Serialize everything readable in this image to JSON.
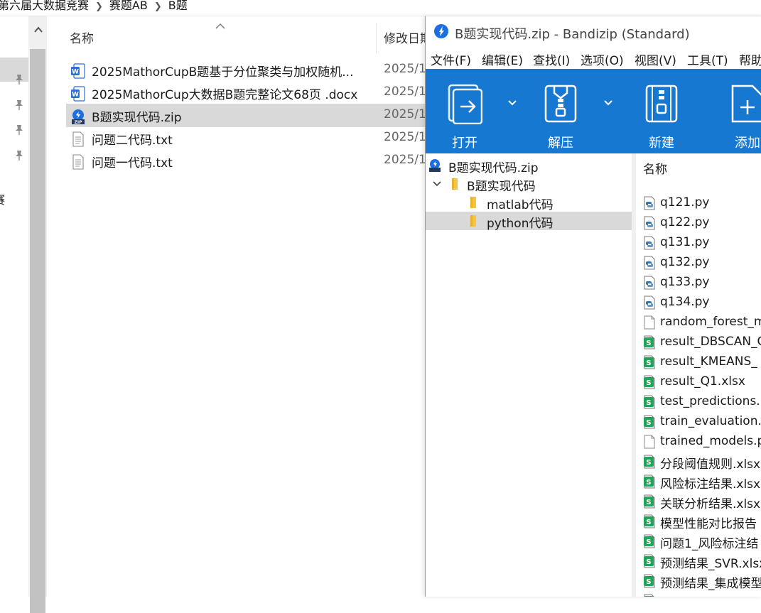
{
  "explorer": {
    "breadcrumb": [
      "第六届大数据竞赛",
      "赛题AB",
      "B题"
    ],
    "nav_partial_text": "赛",
    "columns": {
      "name": "名称",
      "modified": "修改日期"
    },
    "files": [
      {
        "name": "2025MathorCupB题基于分位聚类与加权随机...",
        "date": "2025/1",
        "icon": "word-icon"
      },
      {
        "name": "2025MathorCup大数据B题完整论文68页 .docx",
        "date": "2025/1",
        "icon": "word-icon"
      },
      {
        "name": "B题实现代码.zip",
        "date": "2025/1",
        "icon": "zip-icon",
        "selected": true
      },
      {
        "name": "问题二代码.txt",
        "date": "2025/1",
        "icon": "text-file-icon"
      },
      {
        "name": "问题一代码.txt",
        "date": "2025/1",
        "icon": "text-file-icon"
      }
    ]
  },
  "bandizip": {
    "title": "B题实现代码.zip - Bandizip (Standard)",
    "menu": [
      "文件(F)",
      "编辑(E)",
      "查找(I)",
      "选项(O)",
      "视图(V)",
      "工具(T)",
      "帮助"
    ],
    "toolbar": {
      "open": "打开",
      "extract": "解压",
      "new": "新建",
      "add": "添加"
    },
    "accent_color": "#1778d2",
    "tree": {
      "root": "B题实现代码.zip",
      "folder": "B题实现代码",
      "children": [
        "matlab代码",
        "python代码"
      ],
      "selected": "python代码"
    },
    "list_header": "名称",
    "files": [
      {
        "name": "q121.py",
        "icon": "python-file-icon"
      },
      {
        "name": "q122.py",
        "icon": "python-file-icon"
      },
      {
        "name": "q131.py",
        "icon": "python-file-icon"
      },
      {
        "name": "q132.py",
        "icon": "python-file-icon"
      },
      {
        "name": "q133.py",
        "icon": "python-file-icon"
      },
      {
        "name": "q134.py",
        "icon": "python-file-icon"
      },
      {
        "name": "random_forest_m",
        "icon": "blank-file-icon"
      },
      {
        "name": "result_DBSCAN_C",
        "icon": "spreadsheet-icon"
      },
      {
        "name": "result_KMEANS_",
        "icon": "spreadsheet-icon"
      },
      {
        "name": "result_Q1.xlsx",
        "icon": "spreadsheet-icon"
      },
      {
        "name": "test_predictions.",
        "icon": "spreadsheet-icon"
      },
      {
        "name": "train_evaluation.",
        "icon": "spreadsheet-icon"
      },
      {
        "name": "trained_models.p",
        "icon": "blank-file-icon"
      },
      {
        "name": "分段阈值规则.xlsx",
        "icon": "spreadsheet-icon"
      },
      {
        "name": "风险标注结果.xlsx",
        "icon": "spreadsheet-icon"
      },
      {
        "name": "关联分析结果.xlsx",
        "icon": "spreadsheet-icon"
      },
      {
        "name": "模型性能对比报告",
        "icon": "spreadsheet-icon"
      },
      {
        "name": "问题1_风险标注结",
        "icon": "spreadsheet-icon"
      },
      {
        "name": "预测结果_SVR.xlsx",
        "icon": "spreadsheet-icon"
      },
      {
        "name": "预测结果_集成模型",
        "icon": "spreadsheet-icon"
      },
      {
        "name": "预测结果_随机森林",
        "icon": "spreadsheet-icon"
      }
    ]
  }
}
